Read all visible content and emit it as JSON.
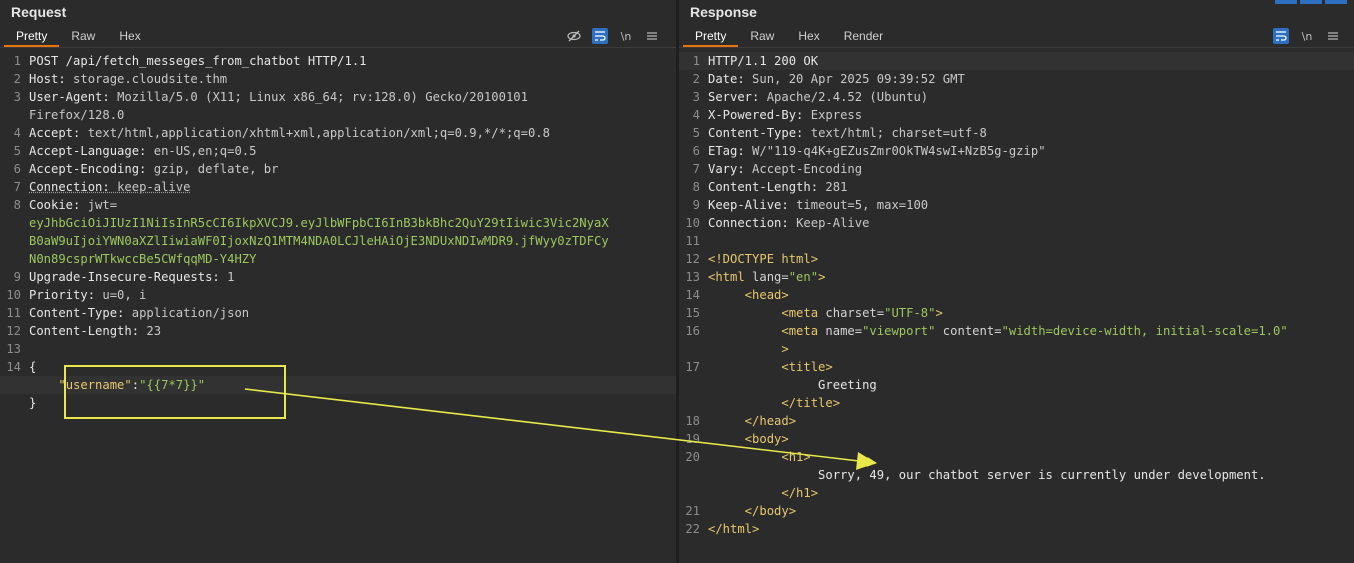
{
  "request": {
    "title": "Request",
    "tabs": [
      "Pretty",
      "Raw",
      "Hex"
    ],
    "tools": {
      "hide": "eye-slash-icon",
      "wrap": "wrap-icon",
      "newline": "\\n",
      "menu": "menu-icon"
    },
    "lines": [
      {
        "n": "1",
        "parts": [
          {
            "t": "POST /api/fetch_messeges_from_chatbot HTTP/1.1",
            "c": "k"
          }
        ]
      },
      {
        "n": "2",
        "parts": [
          {
            "t": "Host: ",
            "c": "k"
          },
          {
            "t": "storage.cloudsite.thm",
            "c": "v"
          }
        ]
      },
      {
        "n": "3",
        "parts": [
          {
            "t": "User-Agent: ",
            "c": "k"
          },
          {
            "t": "Mozilla/5.0 (X11; Linux x86_64; rv:128.0) Gecko/20100101",
            "c": "v"
          }
        ]
      },
      {
        "n": "",
        "parts": [
          {
            "t": "Firefox/128.0",
            "c": "v"
          }
        ]
      },
      {
        "n": "4",
        "parts": [
          {
            "t": "Accept: ",
            "c": "k"
          },
          {
            "t": "text/html,application/xhtml+xml,application/xml;q=0.9,*/*;q=0.8",
            "c": "v"
          }
        ]
      },
      {
        "n": "5",
        "parts": [
          {
            "t": "Accept-Language: ",
            "c": "k"
          },
          {
            "t": "en-US,en;q=0.5",
            "c": "v"
          }
        ]
      },
      {
        "n": "6",
        "parts": [
          {
            "t": "Accept-Encoding: ",
            "c": "k"
          },
          {
            "t": "gzip, deflate, br",
            "c": "v"
          }
        ]
      },
      {
        "n": "7",
        "parts": [
          {
            "t": "Connection: ",
            "c": "k uline"
          },
          {
            "t": "keep-alive",
            "c": "v uline"
          }
        ]
      },
      {
        "n": "8",
        "parts": [
          {
            "t": "Cookie: ",
            "c": "k"
          },
          {
            "t": "jwt=",
            "c": "v"
          }
        ]
      },
      {
        "n": "",
        "parts": [
          {
            "t": "eyJhbGciOiJIUzI1NiIsInR5cCI6IkpXVCJ9.eyJlbWFpbCI6InB3bkBhc2QuY29tIiwic3Vic2NyaX",
            "c": "jwt"
          }
        ]
      },
      {
        "n": "",
        "parts": [
          {
            "t": "B0aW9uIjoiYWN0aXZlIiwiaWF0IjoxNzQ1MTM4NDA0LCJleHAiOjE3NDUxNDIwMDR9.jfWyy0zTDFCy",
            "c": "jwt"
          }
        ]
      },
      {
        "n": "",
        "parts": [
          {
            "t": "N0n89csprWTkwccBe5CWfqqMD-Y4HZY",
            "c": "jwt"
          }
        ]
      },
      {
        "n": "9",
        "parts": [
          {
            "t": "Upgrade-Insecure-Requests: ",
            "c": "k"
          },
          {
            "t": "1",
            "c": "v"
          }
        ]
      },
      {
        "n": "10",
        "parts": [
          {
            "t": "Priority: ",
            "c": "k"
          },
          {
            "t": "u=0, i",
            "c": "v"
          }
        ]
      },
      {
        "n": "11",
        "parts": [
          {
            "t": "Content-Type: ",
            "c": "k"
          },
          {
            "t": "application/json",
            "c": "v"
          }
        ]
      },
      {
        "n": "12",
        "parts": [
          {
            "t": "Content-Length: ",
            "c": "k"
          },
          {
            "t": "23",
            "c": "v"
          }
        ]
      },
      {
        "n": "13",
        "parts": []
      },
      {
        "n": "14",
        "parts": [
          {
            "t": "{",
            "c": "k"
          }
        ]
      },
      {
        "n": "",
        "hl": true,
        "parts": [
          {
            "t": "    ",
            "c": "k"
          },
          {
            "t": "\"username\"",
            "c": "jkey"
          },
          {
            "t": ":",
            "c": "k"
          },
          {
            "t": "\"{{7*7}}\"",
            "c": "str"
          }
        ]
      },
      {
        "n": "",
        "parts": [
          {
            "t": "}",
            "c": "k"
          }
        ]
      }
    ]
  },
  "response": {
    "title": "Response",
    "tabs": [
      "Pretty",
      "Raw",
      "Hex",
      "Render"
    ],
    "tools": {
      "wrap": "wrap-icon",
      "newline": "\\n",
      "menu": "menu-icon"
    },
    "lines": [
      {
        "n": "1",
        "hl": true,
        "parts": [
          {
            "t": "HTTP/1.1 200 OK",
            "c": "k"
          }
        ]
      },
      {
        "n": "2",
        "parts": [
          {
            "t": "Date: ",
            "c": "k"
          },
          {
            "t": "Sun, 20 Apr 2025 09:39:52 GMT",
            "c": "v"
          }
        ]
      },
      {
        "n": "3",
        "parts": [
          {
            "t": "Server: ",
            "c": "k"
          },
          {
            "t": "Apache/2.4.52 (Ubuntu)",
            "c": "v"
          }
        ]
      },
      {
        "n": "4",
        "parts": [
          {
            "t": "X-Powered-By: ",
            "c": "k"
          },
          {
            "t": "Express",
            "c": "v"
          }
        ]
      },
      {
        "n": "5",
        "parts": [
          {
            "t": "Content-Type: ",
            "c": "k"
          },
          {
            "t": "text/html; charset=utf-8",
            "c": "v"
          }
        ]
      },
      {
        "n": "6",
        "parts": [
          {
            "t": "ETag: ",
            "c": "k"
          },
          {
            "t": "W/\"119-q4K+gEZusZmr0OkTW4swI+NzB5g-gzip\"",
            "c": "v"
          }
        ]
      },
      {
        "n": "7",
        "parts": [
          {
            "t": "Vary: ",
            "c": "k"
          },
          {
            "t": "Accept-Encoding",
            "c": "v"
          }
        ]
      },
      {
        "n": "8",
        "parts": [
          {
            "t": "Content-Length: ",
            "c": "k"
          },
          {
            "t": "281",
            "c": "v"
          }
        ]
      },
      {
        "n": "9",
        "parts": [
          {
            "t": "Keep-Alive: ",
            "c": "k"
          },
          {
            "t": "timeout=5, max=100",
            "c": "v"
          }
        ]
      },
      {
        "n": "10",
        "parts": [
          {
            "t": "Connection: ",
            "c": "k"
          },
          {
            "t": "Keep-Alive",
            "c": "v"
          }
        ]
      },
      {
        "n": "11",
        "parts": []
      },
      {
        "n": "12",
        "parts": [
          {
            "t": "<!DOCTYPE html>",
            "c": "tag"
          }
        ]
      },
      {
        "n": "13",
        "parts": [
          {
            "t": "<html ",
            "c": "tag"
          },
          {
            "t": "lang=",
            "c": "attr"
          },
          {
            "t": "\"en\"",
            "c": "str"
          },
          {
            "t": ">",
            "c": "tag"
          }
        ]
      },
      {
        "n": "14",
        "parts": [
          {
            "t": "     <head>",
            "c": "tag"
          }
        ]
      },
      {
        "n": "15",
        "parts": [
          {
            "t": "          <meta ",
            "c": "tag"
          },
          {
            "t": "charset=",
            "c": "attr"
          },
          {
            "t": "\"UTF-8\"",
            "c": "str"
          },
          {
            "t": ">",
            "c": "tag"
          }
        ]
      },
      {
        "n": "16",
        "parts": [
          {
            "t": "          <meta ",
            "c": "tag"
          },
          {
            "t": "name=",
            "c": "attr"
          },
          {
            "t": "\"viewport\"",
            "c": "str"
          },
          {
            "t": " content=",
            "c": "attr"
          },
          {
            "t": "\"width=device-width, initial-scale=1.0\"",
            "c": "str"
          }
        ]
      },
      {
        "n": "",
        "parts": [
          {
            "t": "          >",
            "c": "tag"
          }
        ]
      },
      {
        "n": "17",
        "parts": [
          {
            "t": "          <title>",
            "c": "tag"
          }
        ]
      },
      {
        "n": "",
        "parts": [
          {
            "t": "               Greeting",
            "c": "k"
          }
        ]
      },
      {
        "n": "",
        "parts": [
          {
            "t": "          </title>",
            "c": "tag"
          }
        ]
      },
      {
        "n": "18",
        "parts": [
          {
            "t": "     </head>",
            "c": "tag"
          }
        ]
      },
      {
        "n": "19",
        "parts": [
          {
            "t": "     <body>",
            "c": "tag"
          }
        ]
      },
      {
        "n": "20",
        "parts": [
          {
            "t": "          <h1>",
            "c": "tag"
          }
        ]
      },
      {
        "n": "",
        "parts": [
          {
            "t": "               Sorry, 49, our chatbot server is currently under development.",
            "c": "k"
          }
        ]
      },
      {
        "n": "",
        "parts": [
          {
            "t": "          </h1>",
            "c": "tag"
          }
        ]
      },
      {
        "n": "21",
        "parts": [
          {
            "t": "     </body>",
            "c": "tag"
          }
        ]
      },
      {
        "n": "22",
        "parts": [
          {
            "t": "</html>",
            "c": "tag"
          }
        ]
      }
    ]
  },
  "colors": {
    "accent": "#e8740c",
    "highlight": "#e8e84a",
    "tool_on": "#2d6fc0"
  }
}
